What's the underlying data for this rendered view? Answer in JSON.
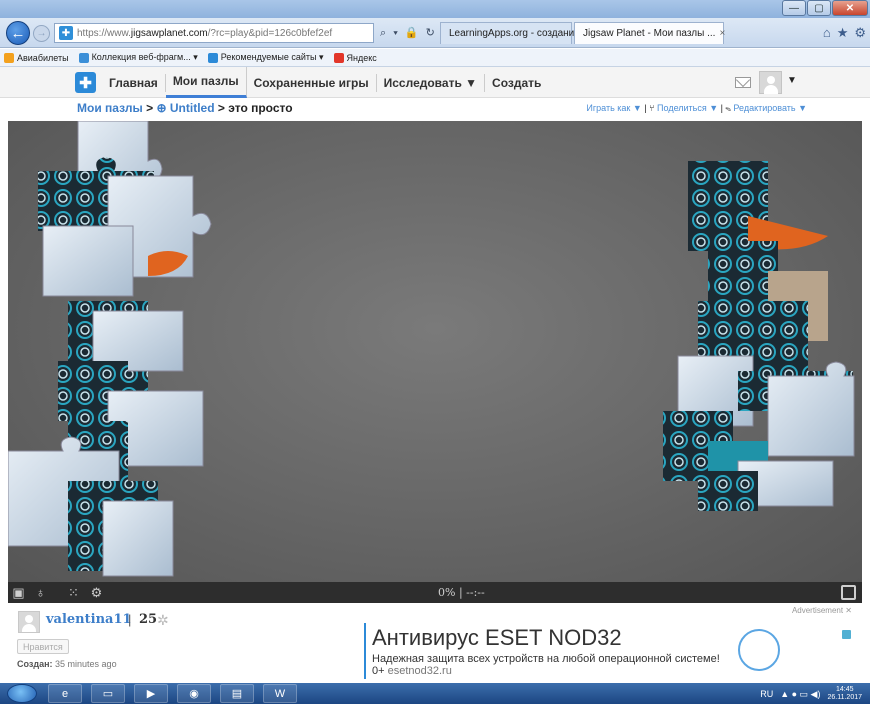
{
  "browser": {
    "url_prefix": "https://www.",
    "url_domain": "jigsawplanet.com",
    "url_path": "/?rc=play&pid=126c0bfef2ef",
    "tools": "⌕ ▾ 🔒 ↻",
    "tabs": [
      {
        "label": "LearningApps.org - создание ..."
      },
      {
        "label": "Jigsaw Planet - Мои пазлы ...",
        "close": "×"
      }
    ],
    "window_controls": {
      "minimize": "—",
      "maximize": "▢",
      "close": "✕"
    },
    "nav_icons": {
      "home": "⌂",
      "favorites": "★",
      "settings": "⚙"
    }
  },
  "favorites": [
    {
      "label": "Авиабилеты",
      "icon": "plane-icon",
      "color": "#f3a11f"
    },
    {
      "label": "Коллекция веб-фрагм... ▾",
      "icon": "ie-icon",
      "color": "#3b8fd8"
    },
    {
      "label": "Рекомендуемые сайты ▾",
      "icon": "sites-icon",
      "color": "#2c8ad8"
    },
    {
      "label": "Яндекс",
      "icon": "yandex-icon",
      "color": "#e2362a"
    }
  ],
  "site_nav": {
    "items": [
      "Главная",
      "Мои пазлы",
      "Сохраненные игры",
      "Исследовать ▼",
      "Создать"
    ],
    "avatar_caret": "▼"
  },
  "breadcrumb": {
    "root": "Мои пазлы",
    "sep": " > ",
    "globe": "⊕",
    "folder": "Untitled",
    "current": "это просто"
  },
  "actions": {
    "play": "Играть как ▼",
    "share": "Поделиться ▼",
    "edit": "Редактировать ▼",
    "sep": " | "
  },
  "board": {
    "colors": {
      "background": "#666666",
      "piece_light": "#c9d8e8",
      "piece_teal": "#1f93a8",
      "piece_dark": "#1b2a33",
      "piece_orange": "#e0641f"
    }
  },
  "board_toolbar": {
    "progress": "0% | --:--",
    "progress_fraction": 0,
    "icons": [
      "picture-icon",
      "ghost-icon",
      "grid-icon",
      "settings-icon"
    ]
  },
  "info": {
    "username": "valentina11",
    "pipe": "|",
    "score": "25",
    "like": "Нравится",
    "created_label": "Создан:",
    "created_value": "35 minutes ago"
  },
  "ad": {
    "label": "Advertisement ✕",
    "title": "Антивирус ESET NOD32",
    "text": "Надежная защита всех устройств на любой операционной системе! 0+",
    "url": "esetnod32.ru"
  },
  "taskbar": {
    "lang": "RU",
    "tray_icons": "▲ ● ▭ ◀)",
    "time": "14:45",
    "date": "26.11.2017"
  }
}
